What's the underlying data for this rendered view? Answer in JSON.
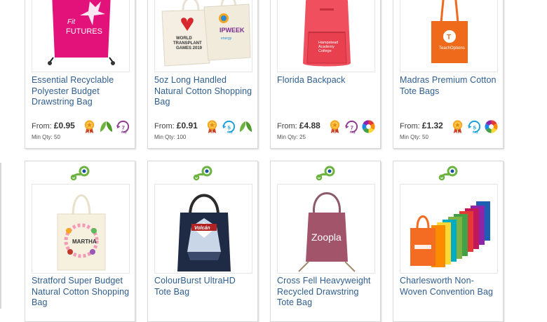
{
  "products": [
    {
      "title": "Essential Recyclable Polyester Budget Drawstring Bag",
      "price_prefix": "From:",
      "price": "£0.95",
      "min_qty": "Min Qty: 50",
      "image_text": "FUTURES"
    },
    {
      "title": "5oz Long Handled Natural Cotton Shopping Bag",
      "price_prefix": "From:",
      "price": "£0.91",
      "min_qty": "Min Qty: 100",
      "image_text": "WORLD TRANSPLANT GAMES 2019",
      "image_text2": "IPWEEK"
    },
    {
      "title": "Florida Backpack",
      "price_prefix": "From:",
      "price": "£4.88",
      "min_qty": "Min Qty: 25",
      "image_text": "Hampstead Academy College"
    },
    {
      "title": "Madras Premium Cotton Tote Bags",
      "price_prefix": "From:",
      "price": "£1.32",
      "min_qty": "Min Qty: 50",
      "image_text": "TeachOptions"
    },
    {
      "title": "Stratford Super Budget Natural Cotton Shopping Bag",
      "image_text": "MARTHA"
    },
    {
      "title": "ColourBurst UltraHD Tote Bag",
      "image_text": "Volcán"
    },
    {
      "title": "Cross Fell Heavyweight Recycled Drawstring Tote Bag",
      "image_text": "Zoopla"
    },
    {
      "title": "Charlesworth Non-Woven Convention Bag"
    }
  ],
  "badges": {
    "award": "award-medal-icon",
    "eco": "leaf-icon",
    "day7": "7day",
    "day5": "5day",
    "colour": "full-colour-icon"
  },
  "colors": {
    "title": "#2e5d90",
    "link_icon": "#6cb33f",
    "pink_bag": "#e2127a",
    "red_backpack": "#f0505e",
    "orange_tote": "#ef6a1a",
    "purple_7day": "#8e3b8f",
    "blue_5day": "#1aa0dc"
  }
}
